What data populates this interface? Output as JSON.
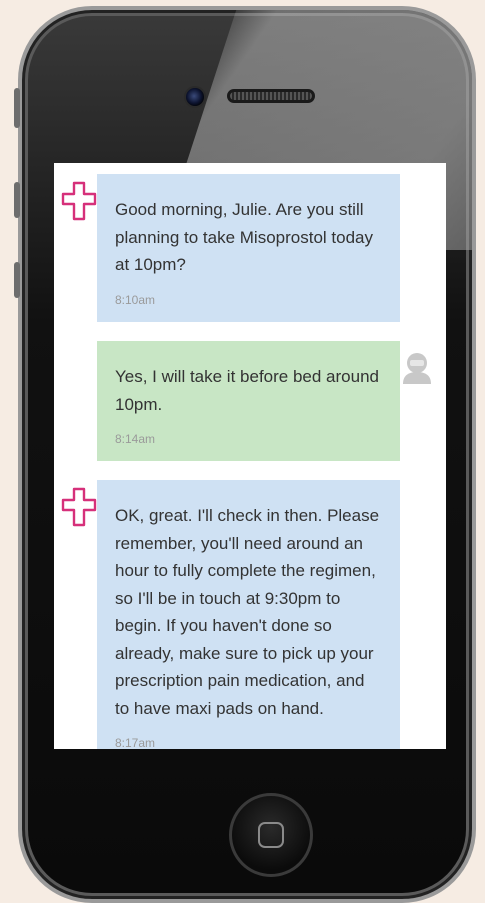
{
  "messages": [
    {
      "sender": "bot",
      "text": "Good morning, Julie. Are you still planning to take Misoprostol today at 10pm?",
      "time": "8:10am"
    },
    {
      "sender": "user",
      "text": "Yes, I will take it before bed around 10pm.",
      "time": "8:14am"
    },
    {
      "sender": "bot",
      "text": "OK, great. I'll check in then. Please remember, you'll need around an hour to fully complete the regimen, so I'll be in touch at 9:30pm to begin. If you haven't done so already, make sure to pick up your prescription pain medication, and to have maxi pads on hand.",
      "time": "8:17am"
    }
  ],
  "icons": {
    "bot_avatar": "medical-cross-icon",
    "user_avatar": "person-icon",
    "home_button": "home-square-icon"
  },
  "colors": {
    "incoming_bubble": "#cfe1f3",
    "outgoing_bubble": "#c8e6c5",
    "bot_icon": "#d6307a",
    "background": "#f6ece3"
  }
}
